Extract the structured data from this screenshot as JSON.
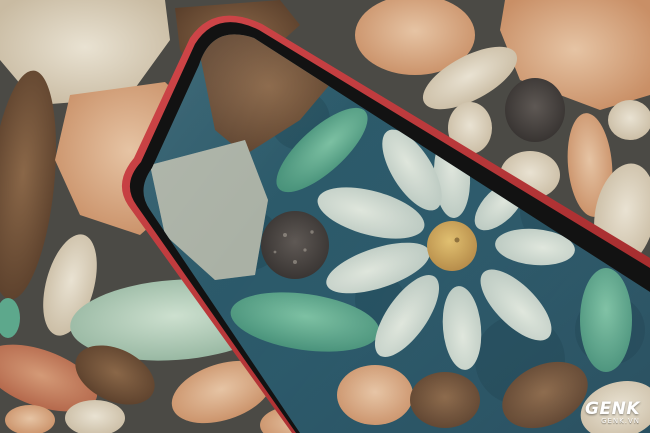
{
  "image": {
    "watermark": {
      "logo": "GENK",
      "domain": "GENK.VN"
    },
    "colors": {
      "grout": "#4a4a46",
      "phone_frame": "#c2393a",
      "screen_bezel": "#111111",
      "wallpaper_blue": "#2a5a6a",
      "petal_white": "#c9d3c9",
      "petal_green": "#5da88c",
      "flower_center": "#c8a157"
    },
    "icons": [
      "front-camera-icon",
      "earpiece-speaker-icon"
    ]
  }
}
